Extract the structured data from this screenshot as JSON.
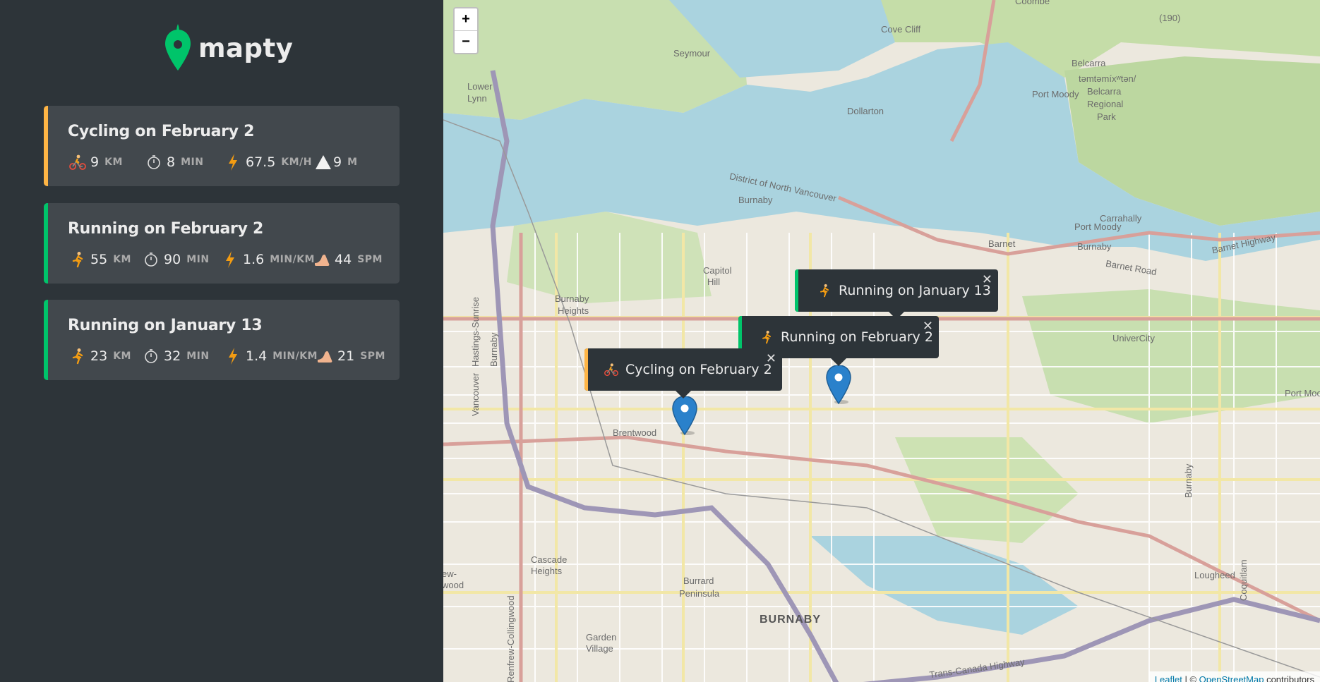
{
  "brand": {
    "name": "mapty"
  },
  "workouts": [
    {
      "type": "cycling",
      "title": "Cycling on February 2",
      "stripe_color": "#ffb545",
      "details": [
        {
          "icon": "cyclist-icon",
          "value": "9",
          "unit": "KM"
        },
        {
          "icon": "stopwatch-icon",
          "value": "8",
          "unit": "MIN"
        },
        {
          "icon": "lightning-icon",
          "value": "67.5",
          "unit": "KM/H"
        },
        {
          "icon": "mountain-icon",
          "value": "9",
          "unit": "M"
        }
      ]
    },
    {
      "type": "running",
      "title": "Running on February 2",
      "stripe_color": "#00c46a",
      "details": [
        {
          "icon": "runner-icon",
          "value": "55",
          "unit": "KM"
        },
        {
          "icon": "stopwatch-icon",
          "value": "90",
          "unit": "MIN"
        },
        {
          "icon": "lightning-icon",
          "value": "1.6",
          "unit": "MIN/KM"
        },
        {
          "icon": "footprint-icon",
          "value": "44",
          "unit": "SPM"
        }
      ]
    },
    {
      "type": "running",
      "title": "Running on January 13",
      "stripe_color": "#00c46a",
      "details": [
        {
          "icon": "runner-icon",
          "value": "23",
          "unit": "KM"
        },
        {
          "icon": "stopwatch-icon",
          "value": "32",
          "unit": "MIN"
        },
        {
          "icon": "lightning-icon",
          "value": "1.4",
          "unit": "MIN/KM"
        },
        {
          "icon": "footprint-icon",
          "value": "21",
          "unit": "SPM"
        }
      ]
    }
  ],
  "map": {
    "zoom_in": "+",
    "zoom_out": "−",
    "popups": [
      {
        "label": "Running on January 13",
        "icon": "runner-icon",
        "stripe_color": "#00c46a",
        "close": "✕"
      },
      {
        "label": "Running on February 2",
        "icon": "runner-icon",
        "stripe_color": "#00c46a",
        "close": "✕"
      },
      {
        "label": "Cycling on February 2",
        "icon": "cyclist-icon",
        "stripe_color": "#ffb545",
        "close": "✕"
      }
    ],
    "place_labels": {
      "coombe": "Coombe",
      "cove_cliff": "Cove Cliff",
      "seymour": "Seymour",
      "lower_lynn_1": "Lower",
      "lower_lynn_2": "Lynn",
      "dollarton": "Dollarton",
      "belcarra": "Belcarra",
      "tamtamix_1": "təmtəmíxʷtən/",
      "tamtamix_2": "Belcarra",
      "tamtamix_3": "Regional",
      "tamtamix_4": "Park",
      "port_moody": "Port Moody",
      "district_nv": "District of North Vancouver",
      "burnaby_small": "Burnaby",
      "carrahally": "Carrahally",
      "port_moody_2": "Port Moody",
      "barnet": "Barnet",
      "burnaby_2": "Burnaby",
      "barnet_highway": "Barnet Highway",
      "barnet_road": "Barnet Road",
      "capitol_1": "Capitol",
      "capitol_2": "Hill",
      "burnaby_heights_1": "Burnaby",
      "burnaby_heights_2": "Heights",
      "hastings_sunrise": "Hastings-Sunrise",
      "burnaby_v": "Burnaby",
      "vancouver_v": "Vancouver",
      "univercity": "UniverCity",
      "port_moo": "Port Moo",
      "brentwood": "Brentwood",
      "cascade_1": "Cascade",
      "cascade_2": "Heights",
      "burrard_1": "Burrard",
      "burrard_2": "Peninsula",
      "garden_1": "Garden",
      "garden_2": "Village",
      "burnaby_big": "BURNABY",
      "renfrew": "Renfrew-Collingwood",
      "trans_canada": "Trans-Canada Highway",
      "lougheed": "Lougheed",
      "coquitlam": "Coquitlam",
      "burnaby_v2": "Burnaby",
      "ewwood_1": "ew-",
      "ewwood_2": "wood",
      "route_190": "(190)"
    },
    "attribution": {
      "leaflet": "Leaflet",
      "sep": " | © ",
      "osm": "OpenStreetMap",
      "tail": " contributors"
    }
  },
  "colors": {
    "sidebar_bg": "#2d3439",
    "card_bg": "#42484d",
    "cycling": "#ffb545",
    "running": "#00c46a",
    "brand_green": "#00c46a",
    "water": "#aad3df",
    "marker_blue": "#2a81cb"
  }
}
